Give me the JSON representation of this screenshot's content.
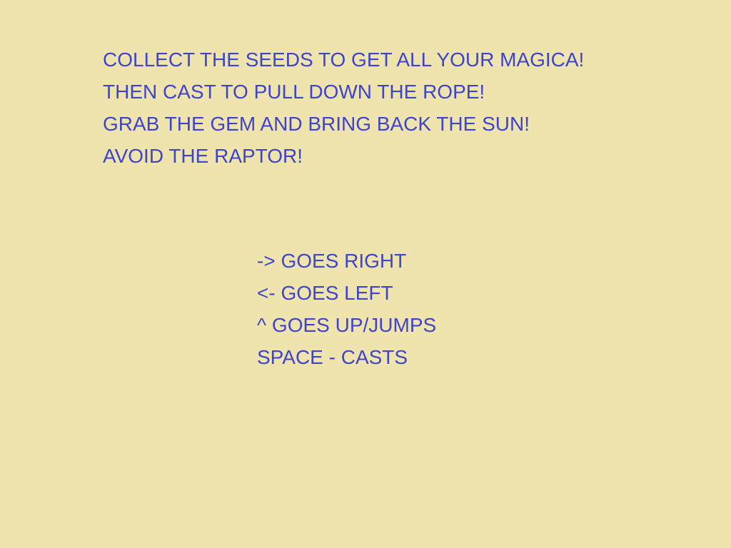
{
  "instructions": [
    "COLLECT THE SEEDS TO GET ALL YOUR MAGICA!",
    "THEN CAST TO PULL DOWN THE ROPE!",
    "GRAB THE GEM AND BRING BACK THE SUN!",
    "AVOID THE RAPTOR!"
  ],
  "controls": [
    "-> GOES RIGHT",
    "<- GOES LEFT",
    "^ GOES UP/JUMPS",
    "SPACE - CASTS"
  ],
  "colors": {
    "background": "#EFE3AE",
    "text": "#3E45C8"
  }
}
